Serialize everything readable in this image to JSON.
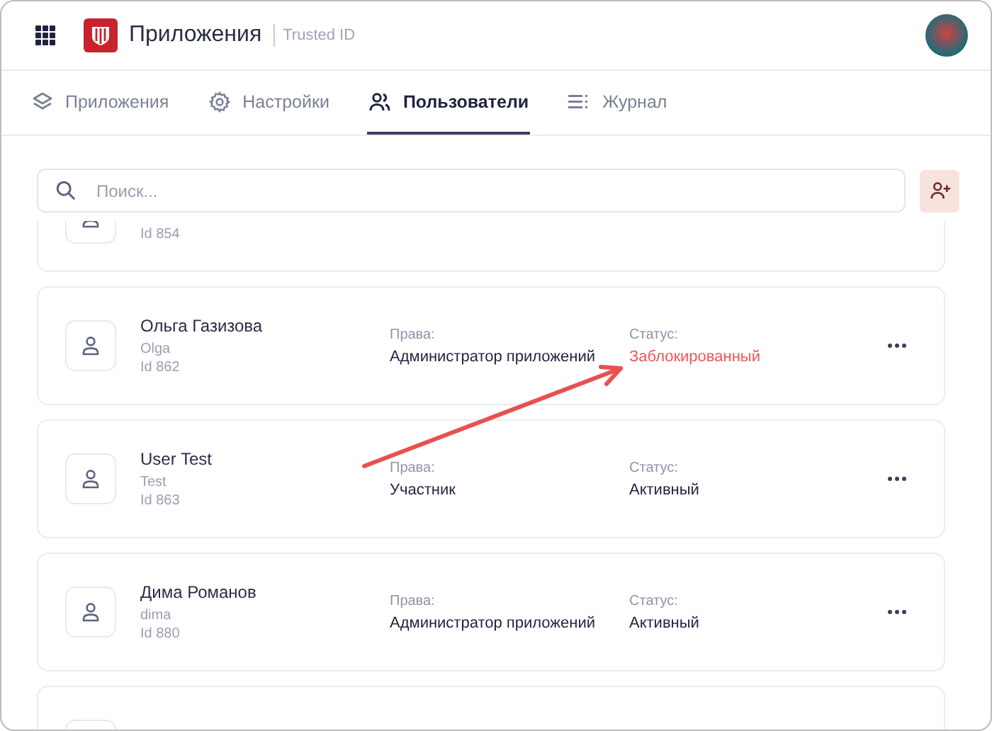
{
  "header": {
    "title": "Приложения",
    "subtitle": "Trusted ID"
  },
  "tabs": [
    {
      "label": "Приложения",
      "selected": false
    },
    {
      "label": "Настройки",
      "selected": false
    },
    {
      "label": "Пользователи",
      "selected": true
    },
    {
      "label": "Журнал",
      "selected": false
    }
  ],
  "search": {
    "placeholder": "Поиск..."
  },
  "users": [
    {
      "kind": "cut_top",
      "id": "Id 854"
    },
    {
      "kind": "full",
      "name": "Ольга Газизова",
      "login": "Olga",
      "id": "Id 862",
      "rights_label": "Права:",
      "rights": "Администратор приложений",
      "status_label": "Статус:",
      "status": "Заблокированный",
      "blocked": true
    },
    {
      "kind": "full",
      "name": "User Test",
      "login": "Test",
      "id": "Id 863",
      "rights_label": "Права:",
      "rights": "Участник",
      "status_label": "Статус:",
      "status": "Активный",
      "blocked": false
    },
    {
      "kind": "full",
      "name": "Дима Романов",
      "login": "dima",
      "id": "Id 880",
      "rights_label": "Права:",
      "rights": "Администратор приложений",
      "status_label": "Статус:",
      "status": "Активный",
      "blocked": false
    },
    {
      "kind": "cut_bottom"
    }
  ]
}
